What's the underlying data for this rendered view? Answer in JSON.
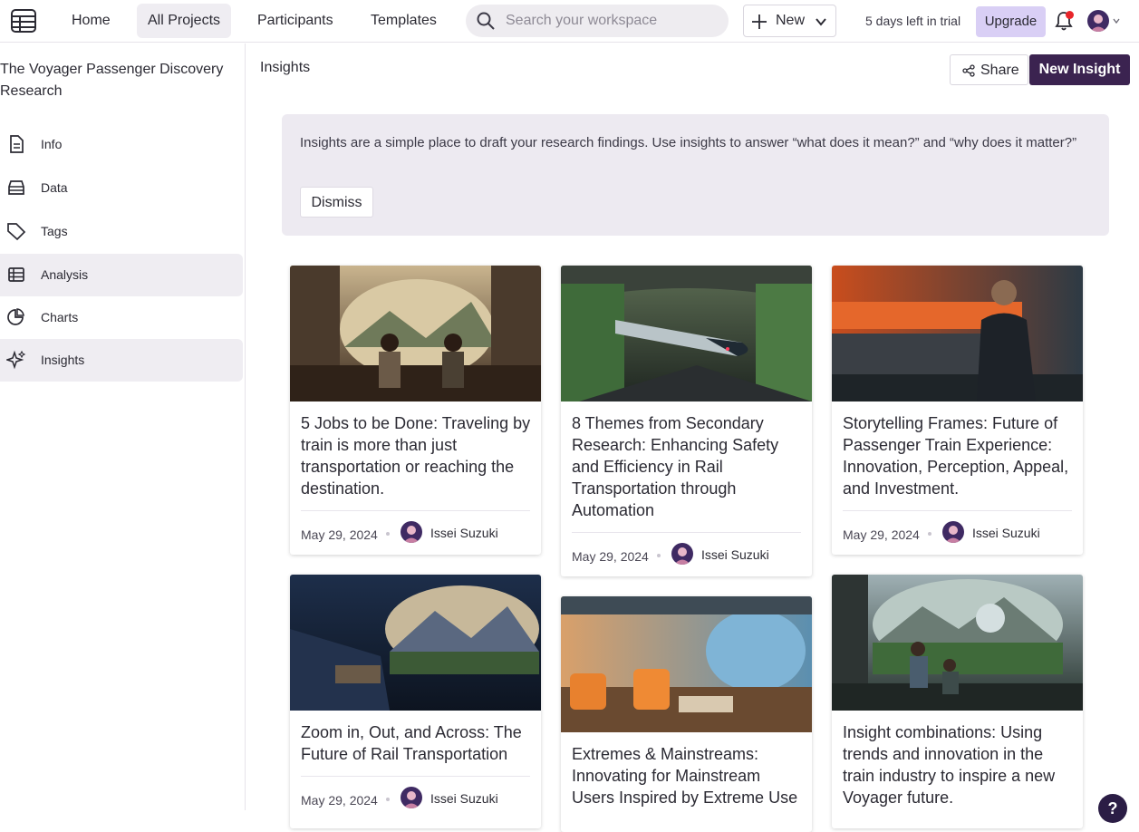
{
  "nav": {
    "home": "Home",
    "all_projects": "All Projects",
    "participants": "Participants",
    "templates": "Templates",
    "search_placeholder": "Search your workspace",
    "new_label": "New",
    "trial_text": "5 days left in trial",
    "upgrade_label": "Upgrade"
  },
  "sidebar": {
    "project_title": "The Voyager Passenger Discovery Research",
    "items": [
      {
        "label": "Info",
        "icon": "document-icon"
      },
      {
        "label": "Data",
        "icon": "database-icon"
      },
      {
        "label": "Tags",
        "icon": "tag-icon"
      },
      {
        "label": "Analysis",
        "icon": "table-icon"
      },
      {
        "label": "Charts",
        "icon": "pie-chart-icon"
      },
      {
        "label": "Insights",
        "icon": "sparkle-icon"
      }
    ]
  },
  "main": {
    "title": "Insights",
    "share_label": "Share",
    "new_insight_label": "New Insight",
    "banner_text": "Insights are a simple place to draft your research findings. Use insights to answer “what does it mean?” and “why does it matter?”",
    "dismiss_label": "Dismiss"
  },
  "cards": [
    {
      "title": "5 Jobs to be Done: Traveling by train is more than just transportation or reaching the destination.",
      "date": "May 29, 2024",
      "author": "Issei Suzuki"
    },
    {
      "title": "8 Themes from Secondary Research: Enhancing Safety and Efficiency in Rail Transportation through Automation",
      "date": "May 29, 2024",
      "author": "Issei Suzuki"
    },
    {
      "title": "Storytelling Frames: Future of Passenger Train Experience: Innovation, Perception, Appeal, and Investment.",
      "date": "May 29, 2024",
      "author": "Issei Suzuki"
    },
    {
      "title": "Zoom in, Out, and Across: The Future of Rail Transportation",
      "date": "May 29, 2024",
      "author": "Issei Suzuki"
    },
    {
      "title": "Extremes & Mainstreams: Innovating for Mainstream Users Inspired by Extreme Use",
      "date": "",
      "author": ""
    },
    {
      "title": "Insight combinations: Using trends and innovation in the train industry to inspire a new Voyager future.",
      "date": "",
      "author": ""
    }
  ],
  "help_label": "?",
  "colors": {
    "accent": "#3b2350",
    "upgrade_bg": "#d9cff5",
    "notification": "#e8252a"
  }
}
